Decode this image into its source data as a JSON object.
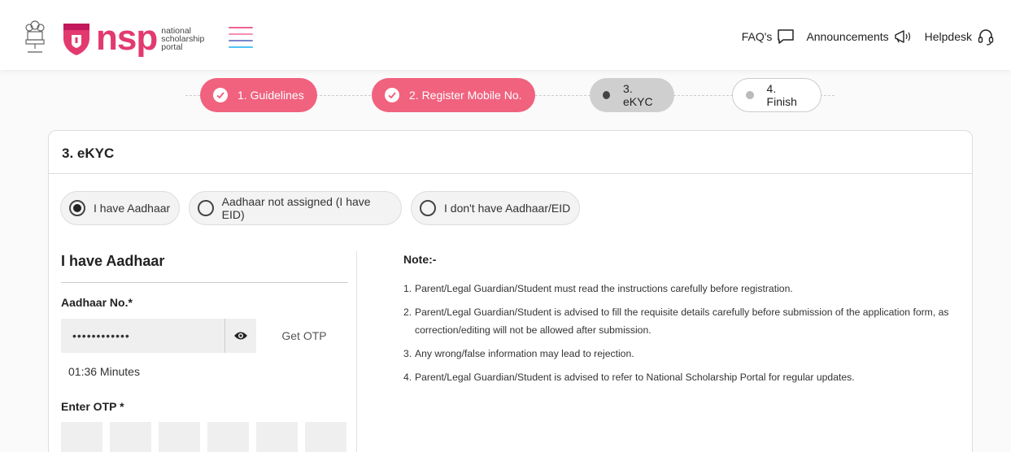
{
  "header": {
    "logo_text": "nsp",
    "logo_subtext": [
      "national",
      "scholarship",
      "portal"
    ],
    "links": [
      {
        "label": "FAQ's",
        "icon": "chat-icon"
      },
      {
        "label": "Announcements",
        "icon": "megaphone-icon"
      },
      {
        "label": "Helpdesk",
        "icon": "headset-icon"
      }
    ],
    "emblem_caption": "सत्यमेव जयते",
    "menu_icon_colors": [
      "#f06292",
      "#f06292",
      "#7986cb",
      "#4fc3f7"
    ]
  },
  "stepper": {
    "steps": [
      {
        "label": "1. Guidelines",
        "state": "done"
      },
      {
        "label": "2. Register Mobile No.",
        "state": "done"
      },
      {
        "label": "3. eKYC",
        "state": "active"
      },
      {
        "label": "4. Finish",
        "state": "todo"
      }
    ]
  },
  "card": {
    "title": "3. eKYC",
    "options": [
      {
        "label": "I have Aadhaar",
        "selected": true
      },
      {
        "label": "Aadhaar not assigned (I have EID)",
        "selected": false
      },
      {
        "label": "I don't have Aadhaar/EID",
        "selected": false
      }
    ],
    "form": {
      "title": "I have Aadhaar",
      "aadhaar_label": "Aadhaar No.*",
      "aadhaar_value": "••••••••••••",
      "get_otp_label": "Get OTP",
      "timer_text": "01:36 Minutes",
      "otp_label": "Enter OTP *",
      "otp_count": 6
    },
    "note": {
      "title": "Note:-",
      "items": [
        {
          "num": "1.",
          "text": "Parent/Legal Guardian/Student must read the instructions carefully before registration."
        },
        {
          "num": "2.",
          "text": "Parent/Legal Guardian/Student is advised to fill the requisite details carefully before submission of the application form, as correction/editing will not be allowed after submission."
        },
        {
          "num": "3.",
          "text": "Any wrong/false information may lead to rejection."
        },
        {
          "num": "4.",
          "text": "Parent/Legal Guardian/Student is advised to refer to National Scholarship Portal for regular updates."
        }
      ]
    }
  },
  "colors": {
    "accent": "#f0627e",
    "brand": "#e23a6f",
    "active_step": "#cfcfcf"
  }
}
